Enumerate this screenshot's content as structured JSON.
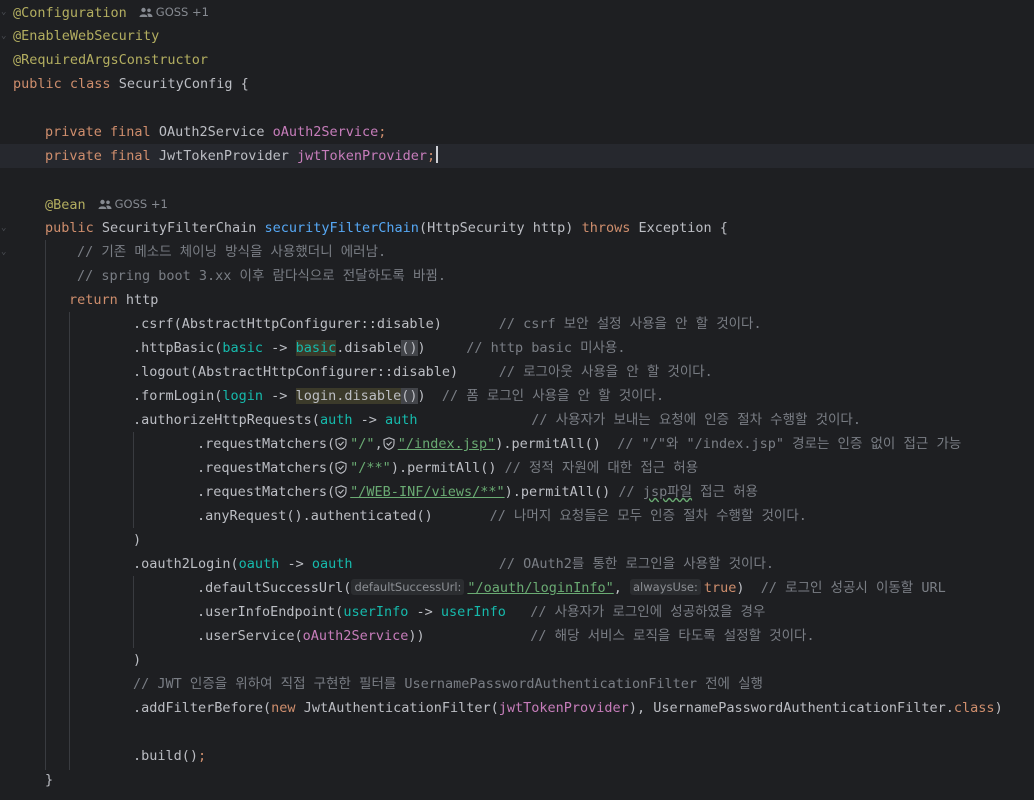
{
  "editor": {
    "language": "java",
    "colors": {
      "background": "#1e1f22",
      "current_line": "#26282e",
      "annotation": "#b3ae60",
      "keyword": "#cf8e6d",
      "field": "#c77dbb",
      "method_declaration": "#56a8f5",
      "comment": "#7a7e85",
      "string": "#6aab73",
      "lambda_parameter": "#16baac"
    },
    "authors_config": "GOSS +1",
    "authors_bean": "GOSS +1",
    "hints": {
      "default_success_url": "defaultSuccessUrl:",
      "always_use": "alwaysUse:"
    },
    "icons": {
      "authors": "people-icon",
      "url": "shield-icon"
    }
  },
  "code": {
    "l1": "@Configuration",
    "l2": "@EnableWebSecurity",
    "l3": "@RequiredArgsConstructor",
    "l4_kw": "public class",
    "l4_name": "SecurityConfig",
    "l4_brace": "{",
    "l6_kw": "private final",
    "l6_type": "OAuth2Service",
    "l6_field": "oAuth2Service",
    "l7_kw": "private final",
    "l7_type": "JwtTokenProvider",
    "l7_field": "jwtTokenProvider",
    "l9": "@Bean",
    "l10_kw": "public",
    "l10_type": "SecurityFilterChain",
    "l10_name": "securityFilterChain",
    "l10_ptype": "HttpSecurity",
    "l10_param": "http",
    "l10_throws": "throws",
    "l10_exc": "Exception",
    "l11": "// 기존 메소드 체이닝 방식을 사용했더니 에러남.",
    "l12": "// spring boot 3.xx 이후 람다식으로 전달하도록 바뀜.",
    "l13_kw": "return",
    "l13_var": "http",
    "l14_code": ".csrf(AbstractHttpConfigurer::disable)",
    "l14_cmt": "// csrf 보안 설정 사용을 안 할 것이다.",
    "l15_a": ".httpBasic(",
    "l15_p": "basic",
    "l15_arrow": " -> ",
    "l15_b": "basic",
    "l15_c": ".disable",
    "l15_d": "()",
    "l15_e": ")",
    "l15_cmt": "// http basic 미사용.",
    "l16_code": ".logout(AbstractHttpConfigurer::disable)",
    "l16_cmt": "// 로그아웃 사용을 안 할 것이다.",
    "l17_a": ".formLogin(",
    "l17_p": "login",
    "l17_arrow": " -> ",
    "l17_b": "login.disable",
    "l17_d": "()",
    "l17_e": ")",
    "l17_cmt": "// 폼 로그인 사용을 안 할 것이다.",
    "l18_a": ".authorizeHttpRequests(",
    "l18_p": "auth",
    "l18_arrow": " -> ",
    "l18_b": "auth",
    "l18_cmt": "// 사용자가 보내는 요청에 인증 절차 수행할 것이다.",
    "l19_a": ".requestMatchers(",
    "l19_s1": "\"/\"",
    "l19_comma": ",",
    "l19_s2": "\"/index.jsp\"",
    "l19_b": ").permitAll()",
    "l19_cmt": "// \"/\"와 \"/index.jsp\" 경로는 인증 없이 접근 가능",
    "l20_a": ".requestMatchers(",
    "l20_s": "\"/**\"",
    "l20_b": ").permitAll()",
    "l20_cmt": "// 정적 자원에 대한 접근 허용",
    "l21_a": ".requestMatchers(",
    "l21_s": "\"/WEB-INF/views/**\"",
    "l21_b": ").permitAll()",
    "l21_cmt_a": "// ",
    "l21_cmt_b": "jsp파일",
    "l21_cmt_c": " 접근 허용",
    "l22_code": ".anyRequest().authenticated()",
    "l22_cmt": "// 나머지 요청들은 모두 인증 절차 수행할 것이다.",
    "l23": ")",
    "l24_a": ".oauth2Login(",
    "l24_p": "oauth",
    "l24_arrow": " -> ",
    "l24_b": "oauth",
    "l24_cmt": "// OAuth2를 통한 로그인을 사용할 것이다.",
    "l25_a": ".defaultSuccessUrl(",
    "l25_s": "\"/oauth/loginInfo\"",
    "l25_comma": ", ",
    "l25_kw": "true",
    "l25_b": ")",
    "l25_cmt": "// 로그인 성공시 이동할 URL",
    "l26_a": ".userInfoEndpoint(",
    "l26_p": "userInfo",
    "l26_arrow": " -> ",
    "l26_b": "userInfo",
    "l26_cmt": "// 사용자가 로그인에 성공하였을 경우",
    "l27_a": ".userService(",
    "l27_f": "oAuth2Service",
    "l27_b": "))",
    "l27_cmt": "// 해당 서비스 로직을 타도록 설정할 것이다.",
    "l28": ")",
    "l29": "// JWT 인증을 위하여 직접 구현한 필터를 UsernamePasswordAuthenticationFilter 전에 실행",
    "l30_a": ".addFilterBefore(",
    "l30_kw": "new",
    "l30_b": " JwtAuthenticationFilter(",
    "l30_f": "jwtTokenProvider",
    "l30_c": "), UsernamePasswordAuthenticationFilter.",
    "l30_kw2": "class",
    "l30_d": ")",
    "l32_a": ".build()",
    "l32_b": ";",
    "l33": "}"
  }
}
